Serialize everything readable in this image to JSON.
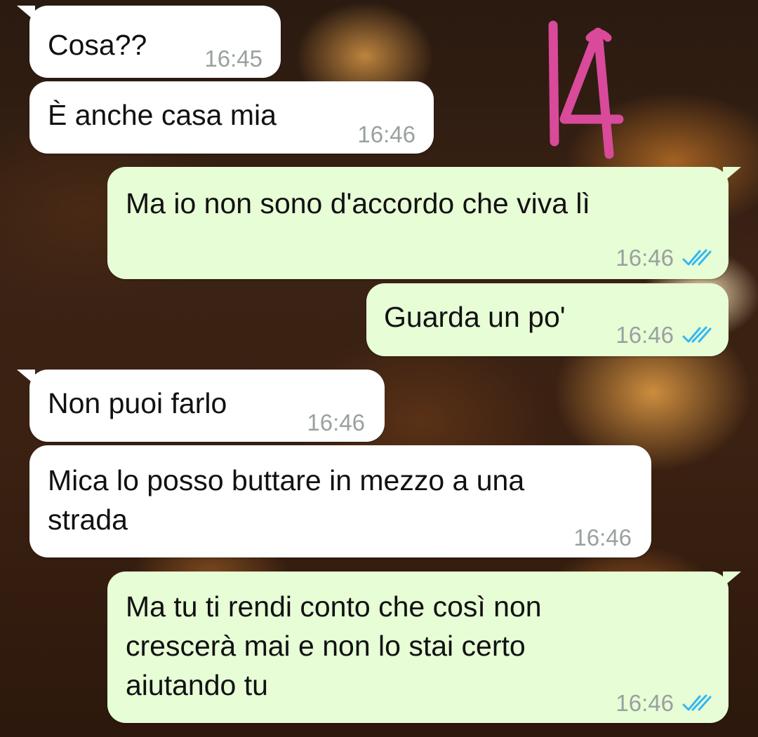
{
  "badge_text": "14",
  "colors": {
    "incoming_bubble": "#ffffff",
    "outgoing_bubble": "#e6fdd6",
    "timestamp": "#9aa0a0",
    "read_ticks": "#34b7f1",
    "badge": "#d94a9a"
  },
  "messages": [
    {
      "direction": "incoming",
      "text": "Cosa??",
      "time": "16:45"
    },
    {
      "direction": "incoming",
      "text": "È anche casa mia",
      "time": "16:46"
    },
    {
      "direction": "outgoing",
      "text": "Ma io non sono d'accordo che viva lì",
      "time": "16:46",
      "status_icon": "double-check-read-icon"
    },
    {
      "direction": "outgoing",
      "text": "Guarda un po'",
      "time": "16:46",
      "status_icon": "double-check-read-icon"
    },
    {
      "direction": "incoming",
      "text": "Non puoi farlo",
      "time": "16:46"
    },
    {
      "direction": "incoming",
      "text": "Mica lo posso buttare in mezzo a una\nstrada",
      "time": "16:46"
    },
    {
      "direction": "outgoing",
      "text": "Ma tu ti rendi conto che così non\ncrescerà mai e non lo stai certo\naiutando tu",
      "time": "16:46",
      "status_icon": "double-check-read-icon"
    }
  ]
}
